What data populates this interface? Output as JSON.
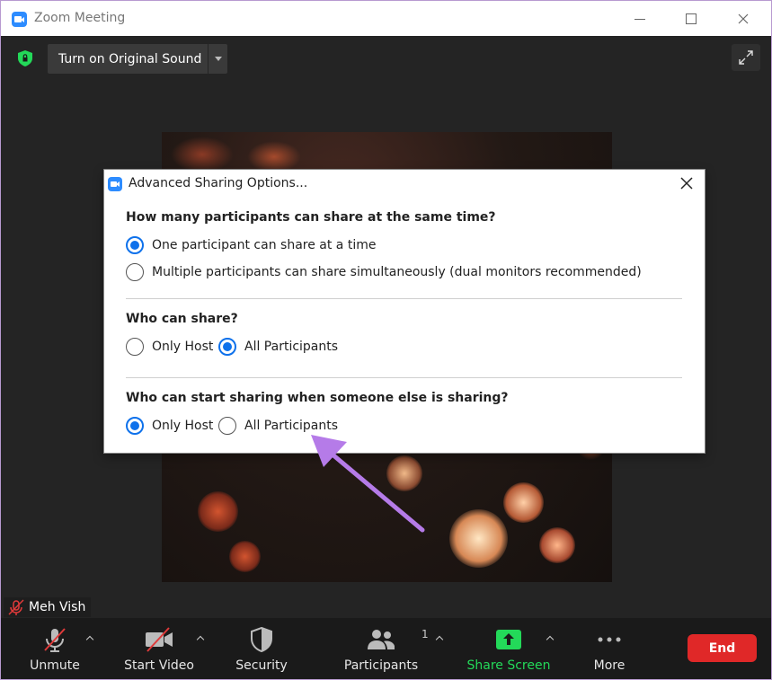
{
  "window": {
    "title": "Zoom Meeting"
  },
  "meeting": {
    "sound_button": "Turn on Original Sound",
    "participant_name": "Meh Vish"
  },
  "toolbar": {
    "unmute": "Unmute",
    "start_video": "Start Video",
    "security": "Security",
    "participants": "Participants",
    "participants_count": "1",
    "share_screen": "Share Screen",
    "more": "More",
    "end": "End"
  },
  "dialog": {
    "title": "Advanced Sharing Options...",
    "sections": [
      {
        "question": "How many participants can share at the same time?",
        "options": [
          {
            "label": "One participant can share at a time",
            "selected": true
          },
          {
            "label": "Multiple participants can share simultaneously (dual monitors recommended)",
            "selected": false
          }
        ]
      },
      {
        "question": "Who can share?",
        "options": [
          {
            "label": "Only Host",
            "selected": false
          },
          {
            "label": "All Participants",
            "selected": true
          }
        ]
      },
      {
        "question": "Who can start sharing when someone else is sharing?",
        "options": [
          {
            "label": "Only Host",
            "selected": true
          },
          {
            "label": "All Participants",
            "selected": false
          }
        ]
      }
    ]
  },
  "colors": {
    "accent_blue": "#0e71eb",
    "share_green": "#23d959",
    "end_red": "#e02828",
    "annotation_purple": "#b57be8"
  }
}
